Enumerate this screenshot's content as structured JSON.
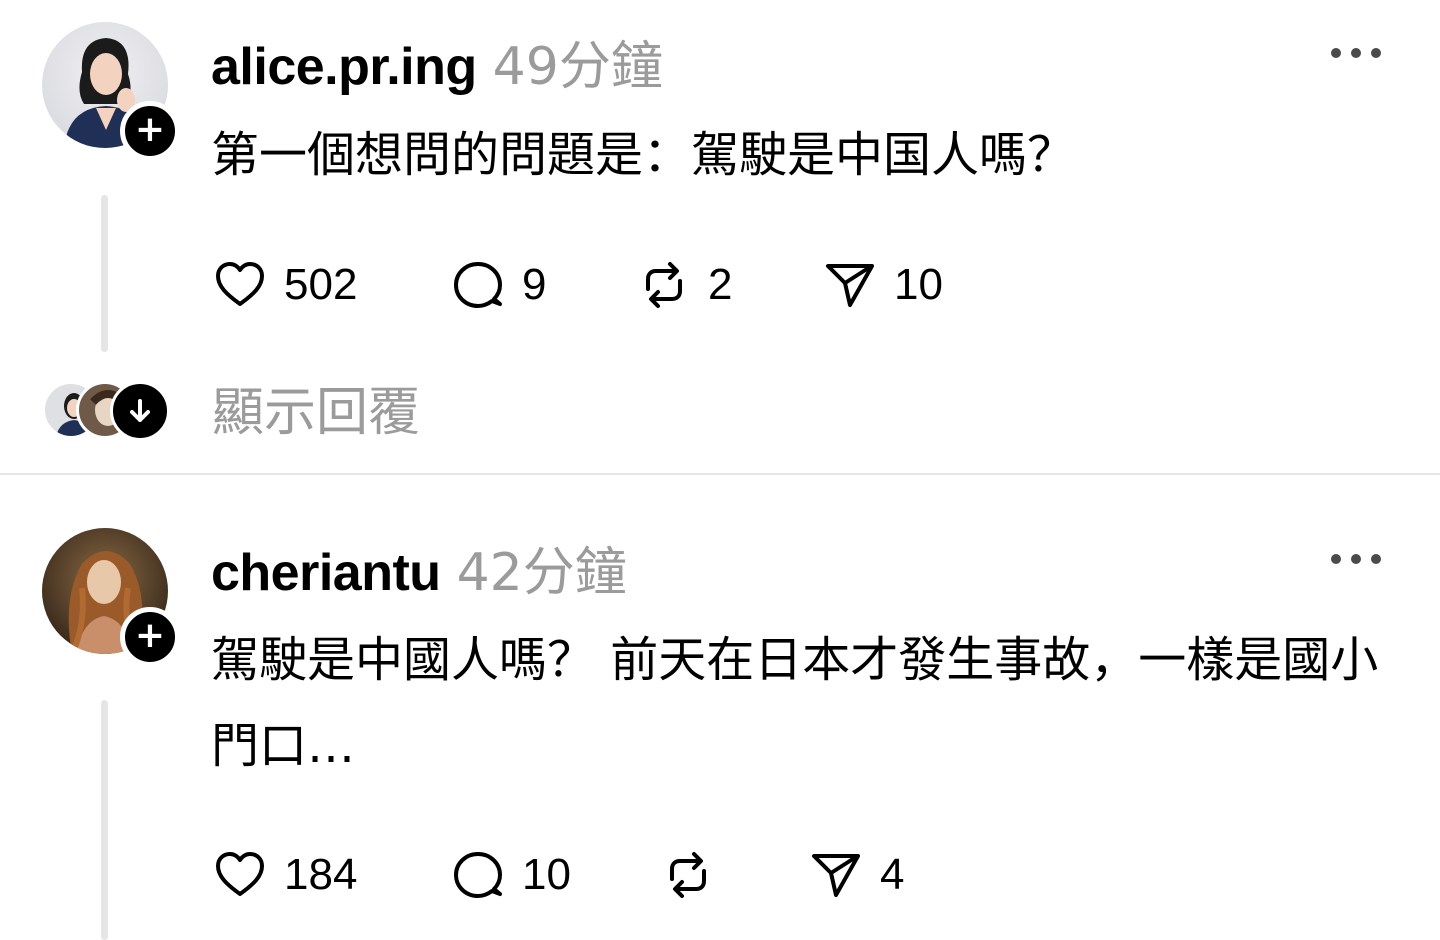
{
  "posts": [
    {
      "username": "alice.pr.ing",
      "time": "49分鐘",
      "text": "第一個想問的問題是：駕駛是中国人嗎？",
      "likes": "502",
      "comments": "9",
      "reposts": "2",
      "shares": "10"
    },
    {
      "username": "cheriantu",
      "time": "42分鐘",
      "text": "駕駛是中國人嗎？ 前天在日本才發生事故，一樣是國小門口…",
      "likes": "184",
      "comments": "10",
      "reposts": "",
      "shares": "4"
    }
  ],
  "replies": {
    "label": "顯示回覆"
  },
  "icons": {
    "like": "heart-icon",
    "comment": "comment-bubble-icon",
    "repost": "repost-icon",
    "share": "send-icon",
    "follow": "plus-icon",
    "more": "more-options-icon",
    "expand": "arrow-down-icon"
  },
  "colors": {
    "secondary_text": "#9b9b9b",
    "thread_line": "#e5e5e5",
    "divider": "#e6e6e6"
  }
}
